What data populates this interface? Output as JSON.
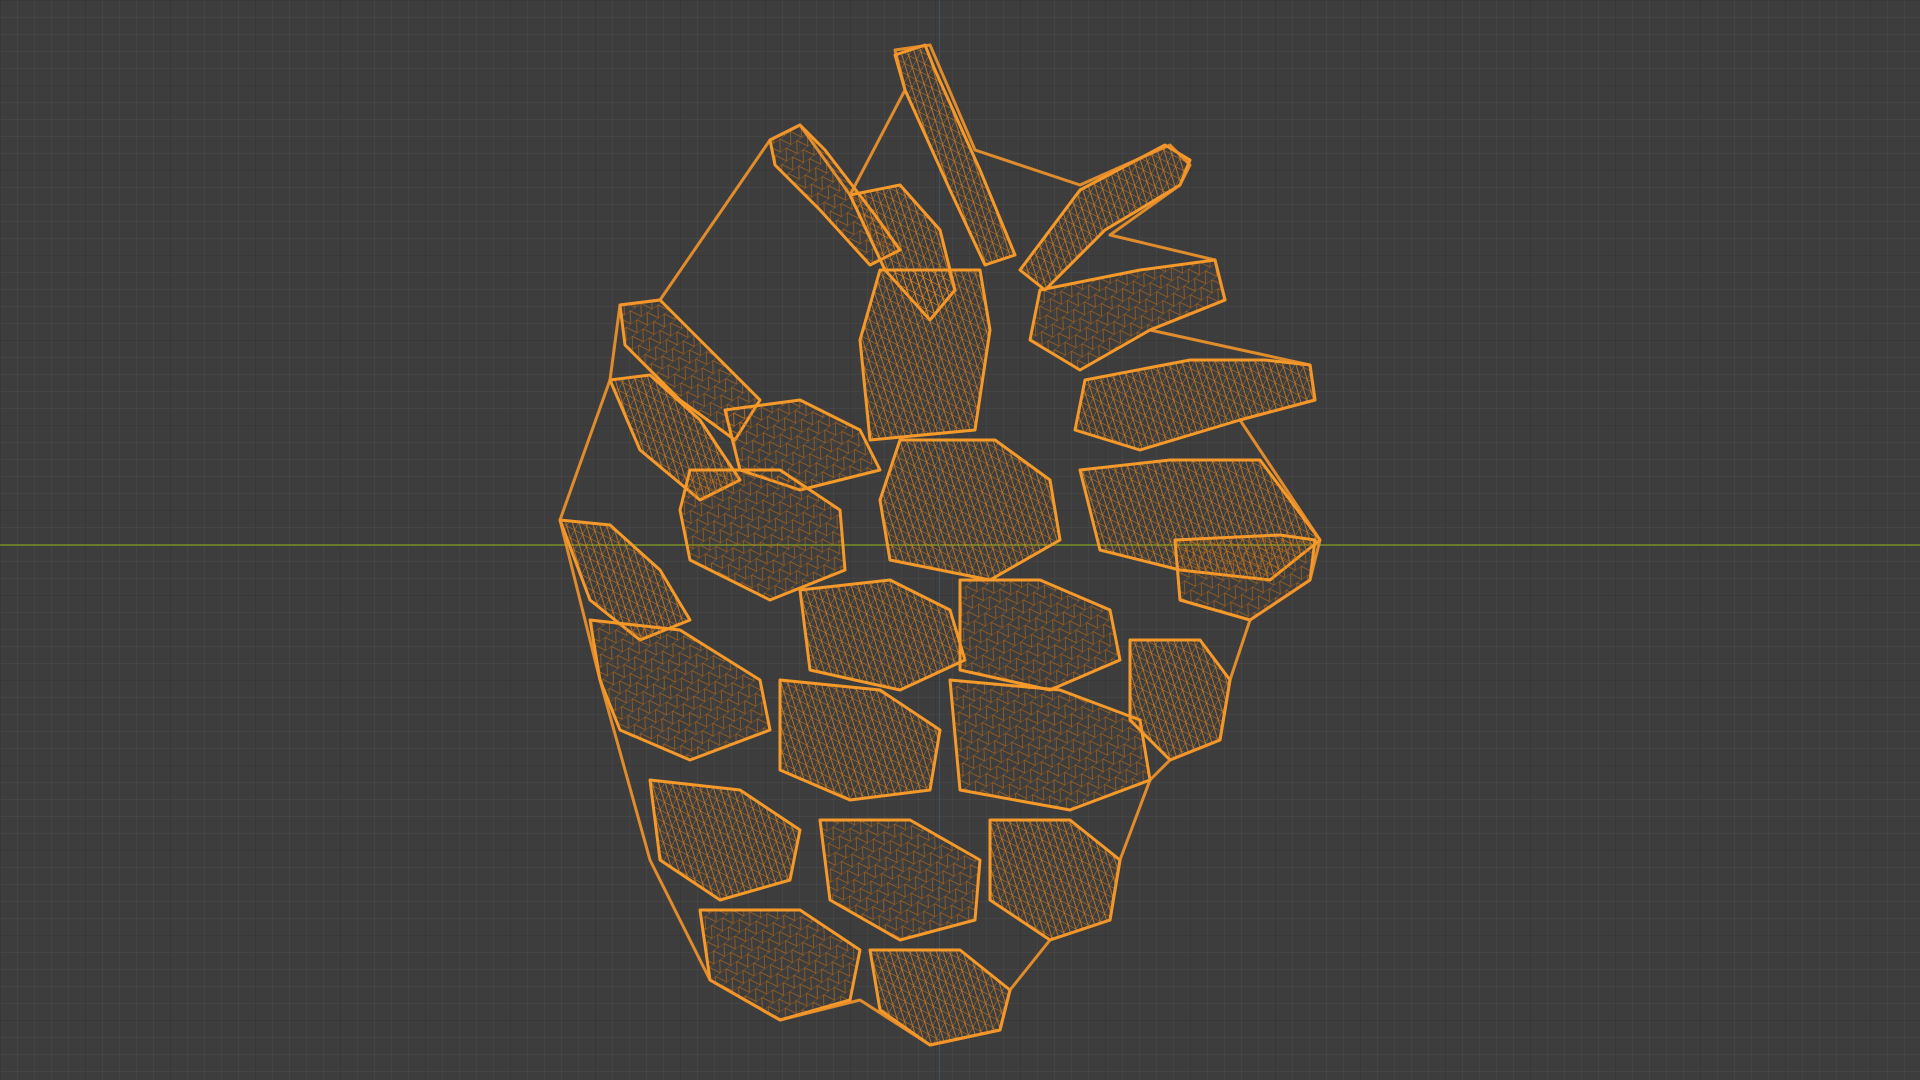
{
  "viewport": {
    "shading_mode": "wireframe",
    "background_color": "#3d3d3d",
    "grid_color": "#333333",
    "x_axis_color": "#6a7a2c",
    "y_axis_color": "#3f4f66"
  },
  "object": {
    "name_semantic": "pine-cone-mesh",
    "wire_color": "#f08a1c",
    "selected": true
  }
}
